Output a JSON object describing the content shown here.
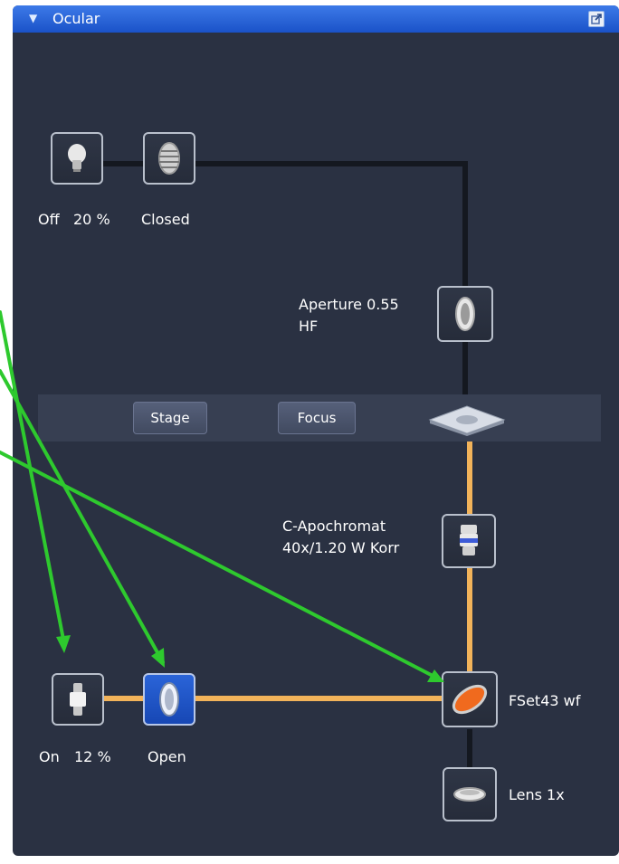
{
  "window": {
    "title": "Ocular",
    "collapse_icon": "triangle-down-icon",
    "undock_icon": "undock-window-icon"
  },
  "top_path": {
    "lamp": {
      "icon": "lightbulb-icon",
      "state": "Off",
      "intensity": "20 %"
    },
    "shutter": {
      "icon": "shutter-icon",
      "label": "Closed"
    },
    "aperture": {
      "icon": "lens-icon",
      "label_line1": "Aperture 0.55",
      "label_line2": "HF"
    }
  },
  "controls": {
    "stage_label": "Stage",
    "focus_label": "Focus"
  },
  "bottom_path": {
    "objective": {
      "icon": "objective-icon",
      "label_line1": "C-Apochromat",
      "label_line2": "40x/1.20 W Korr"
    },
    "lamp": {
      "icon": "lamp-icon",
      "state": "On",
      "intensity": "12 %"
    },
    "shutter": {
      "icon": "shutter-icon",
      "label": "Open"
    },
    "filter": {
      "icon": "filter-icon",
      "label": "FSet43 wf"
    },
    "lens": {
      "icon": "lens-icon",
      "label": "Lens 1x"
    }
  },
  "colors": {
    "panel_background": "#2a3142",
    "title_bar": "#2a62d8",
    "light_path": "#f2b35a",
    "inactive_path": "#141820",
    "active_tile": "#2a64d8",
    "annotation_arrows": "#2ec92e",
    "filter": "#f06a1e"
  }
}
